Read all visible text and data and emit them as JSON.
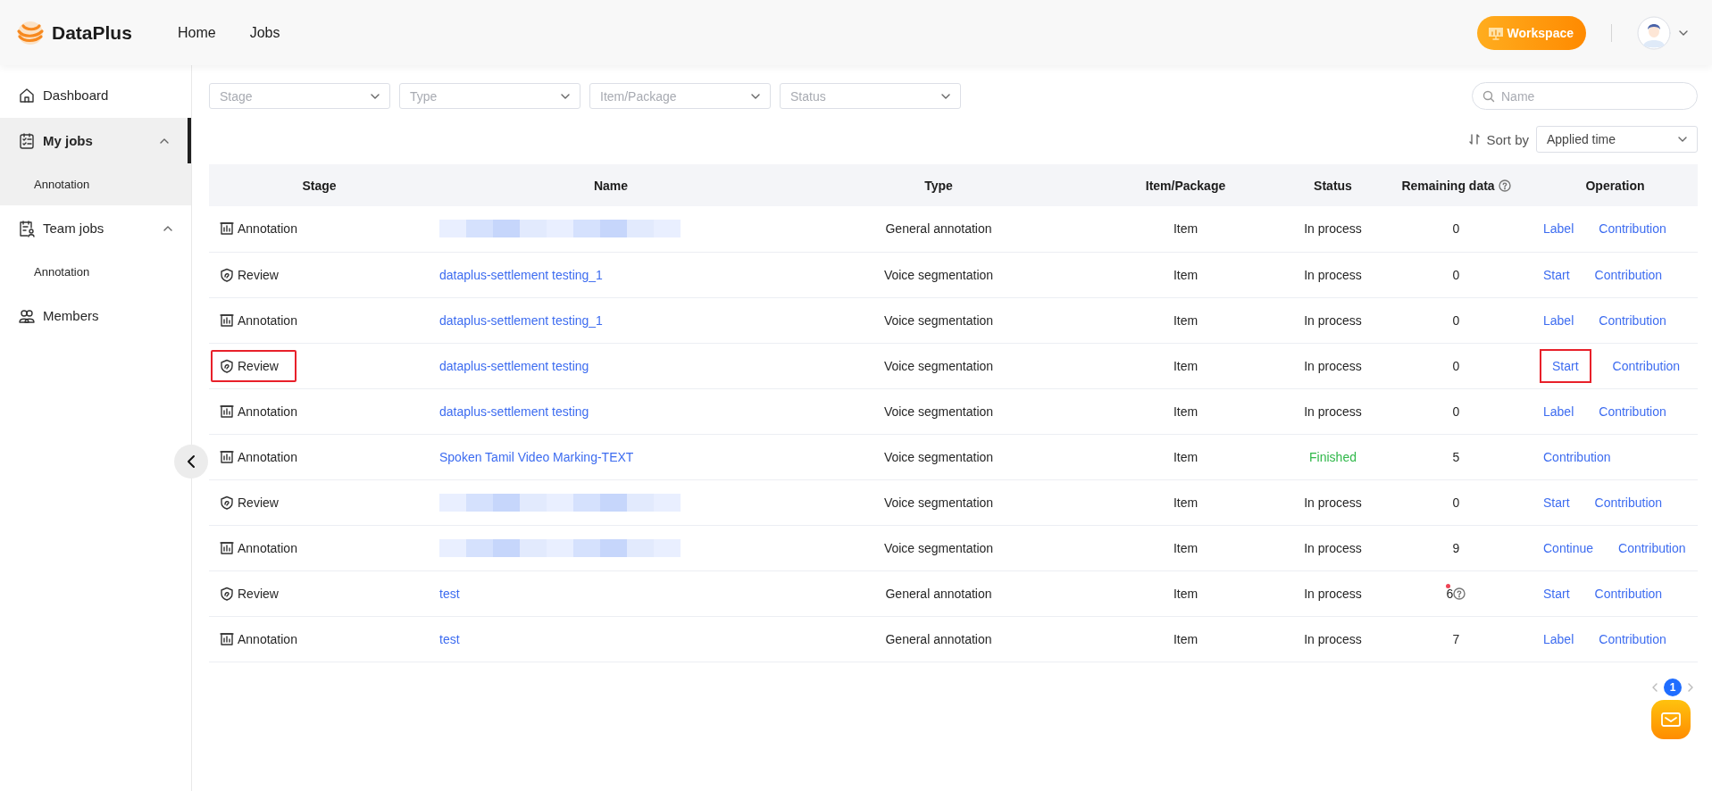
{
  "header": {
    "brand": "DataPlus",
    "nav": [
      {
        "label": "Home"
      },
      {
        "label": "Jobs"
      }
    ],
    "workspace_button": "Workspace"
  },
  "sidebar": {
    "items": [
      {
        "label": "Dashboard",
        "kind": "home",
        "selected": false
      },
      {
        "label": "My jobs",
        "kind": "jobs",
        "selected": true,
        "expanded": true,
        "children": [
          {
            "label": "Annotation",
            "selected": true
          }
        ]
      },
      {
        "label": "Team jobs",
        "kind": "team",
        "selected": false,
        "expanded": true,
        "children": [
          {
            "label": "Annotation",
            "selected": false
          }
        ]
      },
      {
        "label": "Members",
        "kind": "members",
        "selected": false
      }
    ]
  },
  "filters": [
    {
      "placeholder": "Stage"
    },
    {
      "placeholder": "Type"
    },
    {
      "placeholder": "Item/Package"
    },
    {
      "placeholder": "Status"
    }
  ],
  "search": {
    "placeholder": "Name"
  },
  "sort": {
    "label": "Sort by",
    "value": "Applied time"
  },
  "table": {
    "columns": [
      {
        "label": "Stage",
        "hint": false
      },
      {
        "label": "Name",
        "hint": false
      },
      {
        "label": "Type",
        "hint": false
      },
      {
        "label": "Item/Package",
        "hint": false
      },
      {
        "label": "Status",
        "hint": false
      },
      {
        "label": "Remaining data",
        "hint": true
      },
      {
        "label": "Operation",
        "hint": false
      }
    ],
    "rows": [
      {
        "stage": {
          "kind": "annotation",
          "text": "Annotation",
          "highlighted": false
        },
        "name": {
          "kind": "redacted"
        },
        "type": "General annotation",
        "item": "Item",
        "status": {
          "kind": "in_process",
          "text": "In process"
        },
        "remaining": {
          "text": "0",
          "dot": false,
          "hint": false
        },
        "operations": [
          {
            "label": "Label",
            "highlighted": false
          },
          {
            "label": "Contribution",
            "highlighted": false
          }
        ]
      },
      {
        "stage": {
          "kind": "review",
          "text": "Review",
          "highlighted": false
        },
        "name": {
          "kind": "link",
          "text": "dataplus-settlement testing_1"
        },
        "type": "Voice segmentation",
        "item": "Item",
        "status": {
          "kind": "in_process",
          "text": "In process"
        },
        "remaining": {
          "text": "0",
          "dot": false,
          "hint": false
        },
        "operations": [
          {
            "label": "Start",
            "highlighted": false
          },
          {
            "label": "Contribution",
            "highlighted": false
          }
        ]
      },
      {
        "stage": {
          "kind": "annotation",
          "text": "Annotation",
          "highlighted": false
        },
        "name": {
          "kind": "link",
          "text": "dataplus-settlement testing_1"
        },
        "type": "Voice segmentation",
        "item": "Item",
        "status": {
          "kind": "in_process",
          "text": "In process"
        },
        "remaining": {
          "text": "0",
          "dot": false,
          "hint": false
        },
        "operations": [
          {
            "label": "Label",
            "highlighted": false
          },
          {
            "label": "Contribution",
            "highlighted": false
          }
        ]
      },
      {
        "stage": {
          "kind": "review",
          "text": "Review",
          "highlighted": true
        },
        "name": {
          "kind": "link",
          "text": "dataplus-settlement testing"
        },
        "type": "Voice segmentation",
        "item": "Item",
        "status": {
          "kind": "in_process",
          "text": "In process"
        },
        "remaining": {
          "text": "0",
          "dot": false,
          "hint": false
        },
        "operations": [
          {
            "label": "Start",
            "highlighted": true
          },
          {
            "label": "Contribution",
            "highlighted": false
          }
        ]
      },
      {
        "stage": {
          "kind": "annotation",
          "text": "Annotation",
          "highlighted": false
        },
        "name": {
          "kind": "link",
          "text": "dataplus-settlement testing"
        },
        "type": "Voice segmentation",
        "item": "Item",
        "status": {
          "kind": "in_process",
          "text": "In process"
        },
        "remaining": {
          "text": "0",
          "dot": false,
          "hint": false
        },
        "operations": [
          {
            "label": "Label",
            "highlighted": false
          },
          {
            "label": "Contribution",
            "highlighted": false
          }
        ]
      },
      {
        "stage": {
          "kind": "annotation",
          "text": "Annotation",
          "highlighted": false
        },
        "name": {
          "kind": "link",
          "text": "Spoken Tamil Video Marking-TEXT"
        },
        "type": "Voice segmentation",
        "item": "Item",
        "status": {
          "kind": "finished",
          "text": "Finished"
        },
        "remaining": {
          "text": "5",
          "dot": false,
          "hint": false
        },
        "operations": [
          {
            "label": "Contribution",
            "highlighted": false
          }
        ]
      },
      {
        "stage": {
          "kind": "review",
          "text": "Review",
          "highlighted": false
        },
        "name": {
          "kind": "redacted"
        },
        "type": "Voice segmentation",
        "item": "Item",
        "status": {
          "kind": "in_process",
          "text": "In process"
        },
        "remaining": {
          "text": "0",
          "dot": false,
          "hint": false
        },
        "operations": [
          {
            "label": "Start",
            "highlighted": false
          },
          {
            "label": "Contribution",
            "highlighted": false
          }
        ]
      },
      {
        "stage": {
          "kind": "annotation",
          "text": "Annotation",
          "highlighted": false
        },
        "name": {
          "kind": "redacted"
        },
        "type": "Voice segmentation",
        "item": "Item",
        "status": {
          "kind": "in_process",
          "text": "In process"
        },
        "remaining": {
          "text": "9",
          "dot": false,
          "hint": false
        },
        "operations": [
          {
            "label": "Continue",
            "highlighted": false
          },
          {
            "label": "Contribution",
            "highlighted": false
          }
        ]
      },
      {
        "stage": {
          "kind": "review",
          "text": "Review",
          "highlighted": false
        },
        "name": {
          "kind": "link",
          "text": "test"
        },
        "type": "General annotation",
        "item": "Item",
        "status": {
          "kind": "in_process",
          "text": "In process"
        },
        "remaining": {
          "text": "6",
          "dot": true,
          "hint": true
        },
        "operations": [
          {
            "label": "Start",
            "highlighted": false
          },
          {
            "label": "Contribution",
            "highlighted": false
          }
        ]
      },
      {
        "stage": {
          "kind": "annotation",
          "text": "Annotation",
          "highlighted": false
        },
        "name": {
          "kind": "link",
          "text": "test"
        },
        "type": "General annotation",
        "item": "Item",
        "status": {
          "kind": "in_process",
          "text": "In process"
        },
        "remaining": {
          "text": "7",
          "dot": false,
          "hint": false
        },
        "operations": [
          {
            "label": "Label",
            "highlighted": false
          },
          {
            "label": "Contribution",
            "highlighted": false
          }
        ]
      }
    ]
  },
  "pagination": {
    "pages": [
      {
        "label": "1",
        "selected": true
      }
    ]
  }
}
